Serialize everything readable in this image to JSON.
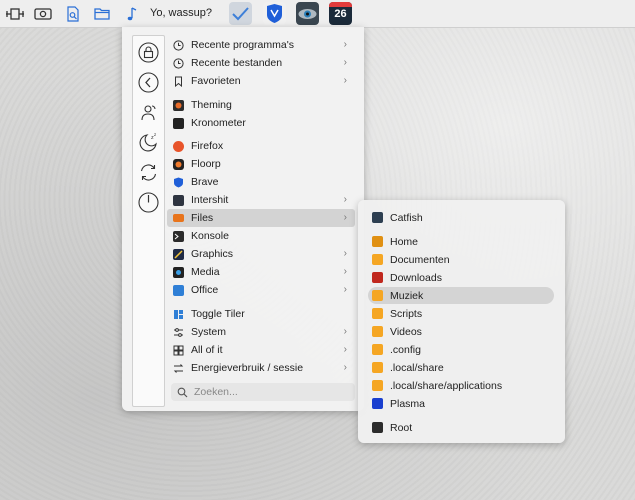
{
  "panel": {
    "greeting": "Yo, wassup?",
    "launcher_icons": [
      "layout-icon",
      "camera-icon",
      "search-doc-icon",
      "folder-icon",
      "music-note-icon"
    ],
    "task_apps": [
      "check-icon",
      "brave-icon",
      "eye-app-icon",
      "calendar-26-icon"
    ],
    "calendar_day": "26"
  },
  "sidebar": {
    "buttons": [
      "lock-icon",
      "back-icon",
      "switch-user-icon",
      "sleep-icon",
      "restart-icon",
      "power-icon"
    ]
  },
  "menu": {
    "items": [
      {
        "label": "Recente programma's",
        "icon": "clock-icon",
        "arrow": true
      },
      {
        "label": "Recente bestanden",
        "icon": "clock-icon",
        "arrow": true
      },
      {
        "label": "Favorieten",
        "icon": "bookmark-icon",
        "arrow": true
      },
      {
        "label": "Theming",
        "icon": "theming-icon",
        "arrow": false
      },
      {
        "label": "Kronometer",
        "icon": "kronometer-icon",
        "arrow": false
      },
      {
        "label": "Firefox",
        "icon": "firefox-icon",
        "arrow": false
      },
      {
        "label": "Floorp",
        "icon": "floorp-icon",
        "arrow": false
      },
      {
        "label": "Brave",
        "icon": "brave-icon",
        "arrow": false
      },
      {
        "label": "Intershit",
        "icon": "internet-icon",
        "arrow": true
      },
      {
        "label": "Files",
        "icon": "files-icon",
        "arrow": true
      },
      {
        "label": "Konsole",
        "icon": "konsole-icon",
        "arrow": false
      },
      {
        "label": "Graphics",
        "icon": "graphics-icon",
        "arrow": true
      },
      {
        "label": "Media",
        "icon": "media-icon",
        "arrow": true
      },
      {
        "label": "Office",
        "icon": "office-icon",
        "arrow": true
      },
      {
        "label": "Toggle Tiler",
        "icon": "tiler-icon",
        "arrow": false
      },
      {
        "label": "System",
        "icon": "system-icon",
        "arrow": true
      },
      {
        "label": "All of it",
        "icon": "grid-icon",
        "arrow": true
      },
      {
        "label": "Energieverbruik / sessie",
        "icon": "energy-icon",
        "arrow": true
      }
    ],
    "active_item": "Files",
    "search_placeholder": "Zoeken..."
  },
  "submenu": {
    "items": [
      {
        "label": "Catfish",
        "icon": "catfish-icon"
      },
      {
        "label": "Home",
        "icon": "folder-home-icon"
      },
      {
        "label": "Documenten",
        "icon": "folder-documents-icon"
      },
      {
        "label": "Downloads",
        "icon": "folder-downloads-icon"
      },
      {
        "label": "Muziek",
        "icon": "folder-music-icon"
      },
      {
        "label": "Scripts",
        "icon": "folder-scripts-icon"
      },
      {
        "label": "Videos",
        "icon": "folder-videos-icon"
      },
      {
        "label": ".config",
        "icon": "folder-config-icon"
      },
      {
        "label": ".local/share",
        "icon": "folder-icon"
      },
      {
        "label": ".local/share/applications",
        "icon": "folder-icon"
      },
      {
        "label": "Plasma",
        "icon": "folder-plasma-icon"
      },
      {
        "label": "Root",
        "icon": "folder-root-icon"
      }
    ],
    "active_item": "Muziek"
  },
  "colors": {
    "folder": "#f5a623",
    "downloads_folder": "#c0281e",
    "plasma_folder": "#1a3fcf",
    "root_folder": "#2b2b2b",
    "active_row": "#d3d3d3"
  }
}
